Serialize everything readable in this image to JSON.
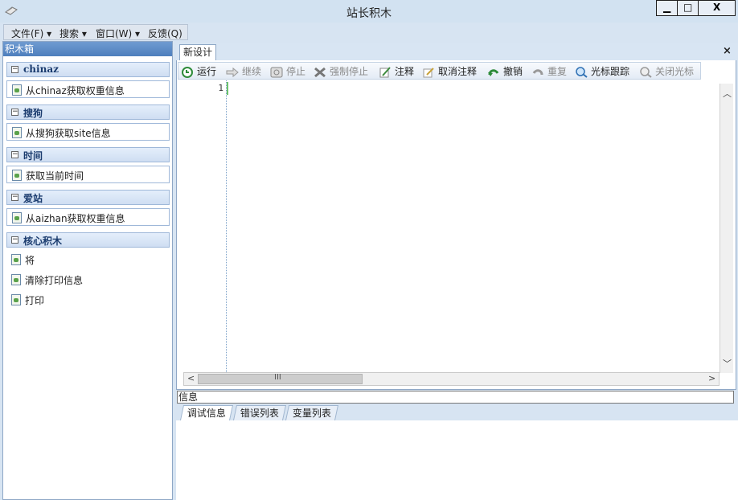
{
  "window": {
    "title": "站长积木",
    "min_label": "▁",
    "max_label": "□",
    "close_label": "X"
  },
  "menu": [
    "文件(F) ▾",
    "搜索 ▾",
    "窗口(W) ▾",
    "反馈(Q)"
  ],
  "toolbox": {
    "title": "积木箱",
    "groups": [
      {
        "label": "chinaz",
        "items": [
          "从chinaz获取权重信息"
        ]
      },
      {
        "label": "搜狗",
        "items": [
          "从搜狗获取site信息"
        ]
      },
      {
        "label": "时间",
        "items": [
          "获取当前时间"
        ]
      },
      {
        "label": "爱站",
        "items": [
          "从aizhan获取权重信息"
        ]
      },
      {
        "label": "核心积木",
        "items": [
          "将",
          "清除打印信息",
          "打印"
        ]
      }
    ]
  },
  "editor": {
    "tab": "新设计",
    "close_label": "×",
    "line_number": "1",
    "toolbar": [
      {
        "label": "运行",
        "icon": "run-icon",
        "enabled": true
      },
      {
        "label": "继续",
        "icon": "continue-icon",
        "enabled": false
      },
      {
        "label": "停止",
        "icon": "stop-icon",
        "enabled": false
      },
      {
        "label": "强制停止",
        "icon": "force-stop-icon",
        "enabled": false
      },
      {
        "label": "注释",
        "icon": "comment-icon",
        "enabled": true
      },
      {
        "label": "取消注释",
        "icon": "uncomment-icon",
        "enabled": true
      },
      {
        "label": "撤销",
        "icon": "undo-icon",
        "enabled": true
      },
      {
        "label": "重复",
        "icon": "redo-icon",
        "enabled": false
      },
      {
        "label": "光标跟踪",
        "icon": "cursor-track-icon",
        "enabled": true
      },
      {
        "label": "关闭光标",
        "icon": "close-cursor-icon",
        "enabled": false
      }
    ],
    "hscroll_thumb": "III"
  },
  "info": {
    "label": "信息",
    "tabs": [
      "调试信息",
      "错误列表",
      "变量列表"
    ]
  }
}
